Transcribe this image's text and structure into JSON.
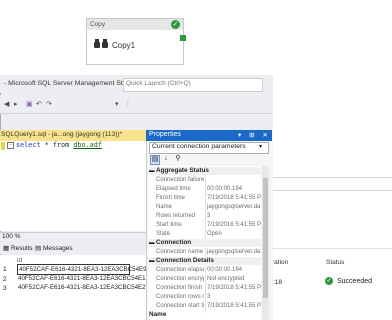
{
  "activity": {
    "header": "Copy",
    "name": "Copy1",
    "status_color": "#2c9a3c"
  },
  "ssms": {
    "title": "- Microsoft SQL Server Management Studio",
    "quick_launch_placeholder": "Quick Launch (Ctrl+Q)",
    "document_tab": "SQLQuery1.sql - ja...ong (jaygong (113))*",
    "query": {
      "select": "select",
      "star_from": " * from ",
      "table": "dbo.adf"
    },
    "zoom": "100 %",
    "results_tab": "Results",
    "messages_tab": "Messages",
    "results": {
      "column": "id",
      "rows": [
        {
          "n": "1",
          "id": "40F52CAF-E616-4321-8EA3-12EA3CBC54E9"
        },
        {
          "n": "2",
          "id": "40F52CAF-E616-4321-8EA3-12EA3CBC54E1"
        },
        {
          "n": "3",
          "id": "40F52CAF-E616-4321-8EA3-12EA3CBC54E2"
        }
      ]
    }
  },
  "properties": {
    "title": "Properties",
    "selected": "Current connection parameters",
    "categories": [
      {
        "name": "Aggregate Status",
        "rows": [
          {
            "name": "Connection failure",
            "value": ""
          },
          {
            "name": "Elapsed time",
            "value": "00:00:00.194"
          },
          {
            "name": "Finish time",
            "value": "7/19/2018 5:41:55 PM"
          },
          {
            "name": "Name",
            "value": "jaygongsqlserver.da"
          },
          {
            "name": "Rows returned",
            "value": "3"
          },
          {
            "name": "Start time",
            "value": "7/19/2018 5:41:55 PM"
          },
          {
            "name": "State",
            "value": "Open"
          }
        ]
      },
      {
        "name": "Connection",
        "rows": [
          {
            "name": "Connection name",
            "value": "jaygongsqlserver.da"
          }
        ]
      },
      {
        "name": "Connection Details",
        "rows": [
          {
            "name": "Connection elapsed",
            "value": "00:00:00.194"
          },
          {
            "name": "Connection encrypt",
            "value": "Not encrypted"
          },
          {
            "name": "Connection finish t",
            "value": "7/19/2018 5:41:55 PM"
          },
          {
            "name": "Connection rows re",
            "value": "3"
          },
          {
            "name": "Connection start ti",
            "value": "7/19/2018 5:41:55 PM"
          }
        ]
      },
      {
        "name": "Name",
        "rows": []
      }
    ]
  },
  "monitor": {
    "col_duration": "ration",
    "col_status": "Status",
    "duration": ":18",
    "status": "Succeeded",
    "status_color": "#2c9a3c"
  }
}
